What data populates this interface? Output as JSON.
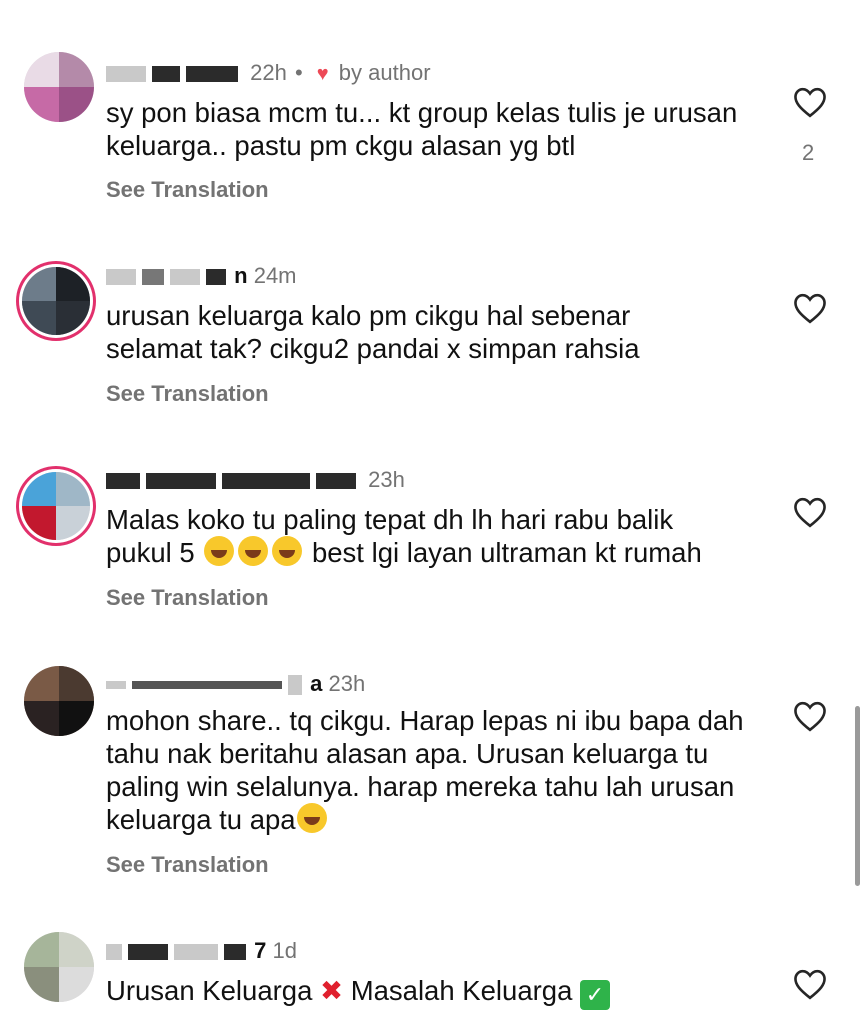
{
  "comments": [
    {
      "time": "22h",
      "dot": "•",
      "by_author": "by author",
      "text": "sy pon biasa mcm tu... kt group kelas tulis je urusan keluarga.. pastu pm ckgu alasan yg btl",
      "translate": "See Translation",
      "like_count": "2"
    },
    {
      "user_tail": "n",
      "time": "24m",
      "text": "urusan keluarga kalo pm cikgu hal sebenar selamat tak? cikgu2 pandai x simpan rahsia",
      "translate": "See Translation"
    },
    {
      "time": "23h",
      "text_1": "Malas koko tu paling tepat dh lh hari rabu balik",
      "text_2a": "pukul 5",
      "text_2b": "best lgi layan ultraman kt rumah",
      "translate": "See Translation"
    },
    {
      "user_tail": "a",
      "time": "23h",
      "text": "mohon share.. tq cikgu. Harap lepas ni ibu bapa dah tahu nak beritahu alasan apa. Urusan keluarga tu paling win selalunya. harap mereka tahu lah urusan keluarga tu apa",
      "translate": "See Translation"
    },
    {
      "user_tail": "7",
      "time": "1d",
      "text_a": "Urusan Keluarga",
      "x_glyph": "✖",
      "text_b": "Masalah Keluarga",
      "check_glyph": "✓"
    }
  ],
  "icons": {
    "like": "heart-outline-icon",
    "liked_by_author": "heart-filled-icon"
  },
  "colors": {
    "text": "#111111",
    "muted": "#737373",
    "heart": "#ed4956"
  }
}
